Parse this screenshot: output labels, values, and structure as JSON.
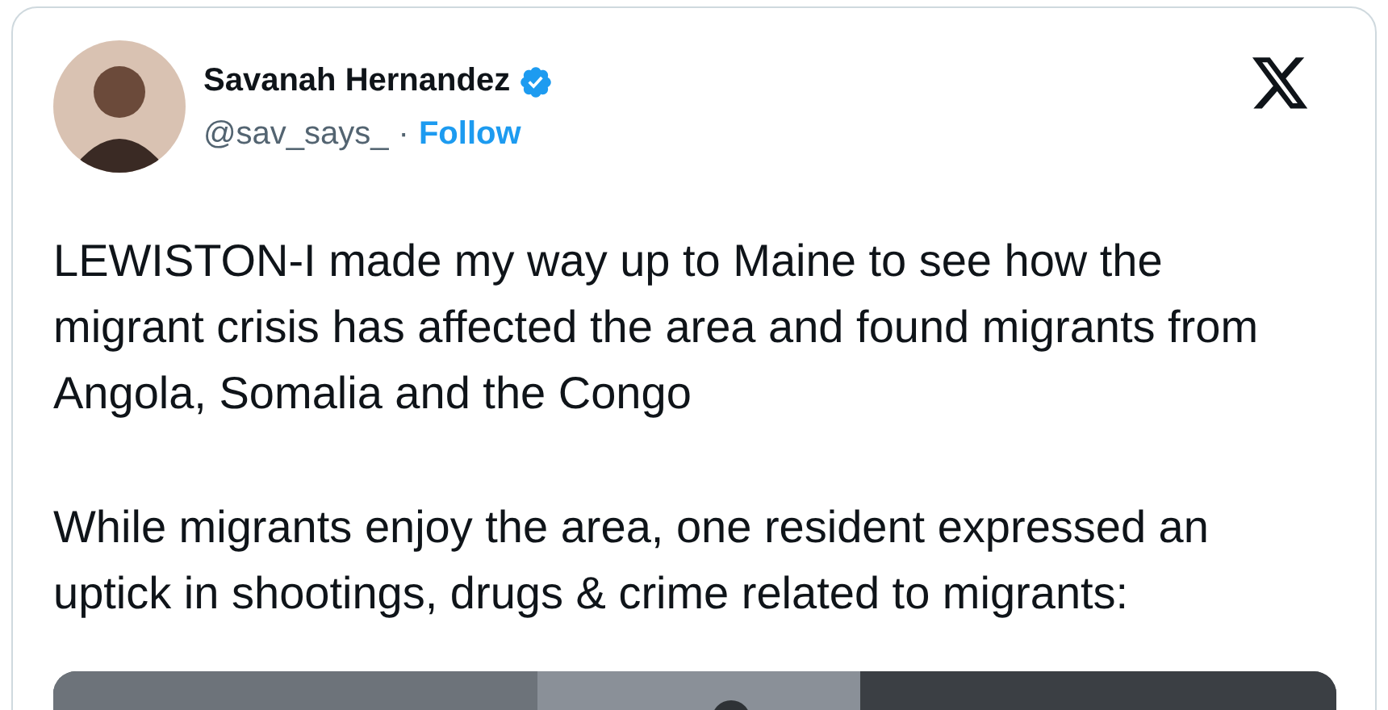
{
  "author": {
    "name": "Savanah Hernandez",
    "verified": true,
    "handle": "@sav_says_",
    "separator": "·",
    "follow": "Follow"
  },
  "body": [
    "LEWISTON-I made my way up to Maine to see how the migrant crisis has affected the area and found migrants from Angola, Somalia and the Congo",
    "While migrants enjoy the area, one resident expressed an uptick in shootings, drugs & crime related to migrants:"
  ]
}
